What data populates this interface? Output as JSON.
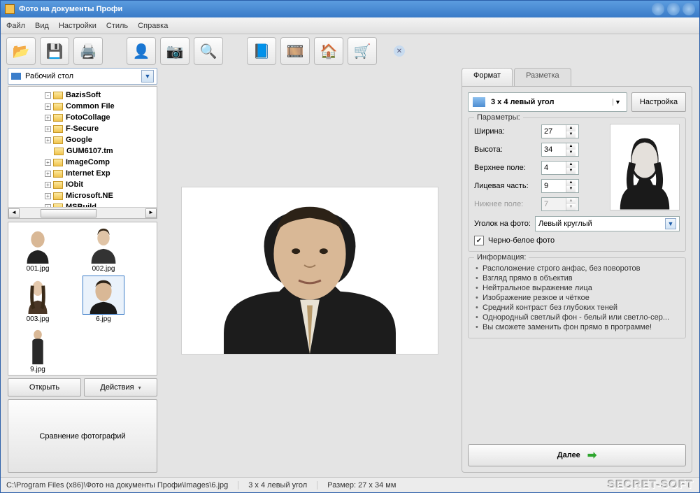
{
  "title": "Фото на документы Профи",
  "menu": [
    "Файл",
    "Вид",
    "Настройки",
    "Стиль",
    "Справка"
  ],
  "toolbar_icons": [
    "open-icon",
    "save-icon",
    "print-icon",
    "retouch-icon",
    "camera-icon",
    "search-icon",
    "help-icon",
    "video-icon",
    "home-icon",
    "cart-icon"
  ],
  "location": "Рабочий стол",
  "tree": [
    {
      "exp": "-",
      "label": "BazisSoft"
    },
    {
      "exp": "+",
      "label": "Common File"
    },
    {
      "exp": "+",
      "label": "FotoCollage"
    },
    {
      "exp": "+",
      "label": "F-Secure"
    },
    {
      "exp": "+",
      "label": "Google"
    },
    {
      "exp": "",
      "label": "GUM6107.tm"
    },
    {
      "exp": "+",
      "label": "ImageComp"
    },
    {
      "exp": "+",
      "label": "Internet Exp"
    },
    {
      "exp": "+",
      "label": "IObit"
    },
    {
      "exp": "+",
      "label": "Microsoft.NE"
    },
    {
      "exp": "+",
      "label": "MSBuild"
    }
  ],
  "thumbs": [
    {
      "name": "001.jpg",
      "sel": false
    },
    {
      "name": "002.jpg",
      "sel": false
    },
    {
      "name": "003.jpg",
      "sel": false
    },
    {
      "name": "6.jpg",
      "sel": true
    },
    {
      "name": "9.jpg",
      "sel": false
    }
  ],
  "buttons": {
    "open": "Открыть",
    "actions": "Действия",
    "compare": "Сравнение фотографий"
  },
  "tabs": {
    "format": "Формат",
    "markup": "Разметка"
  },
  "format_combo": "3 x 4 левый угол",
  "configure": "Настройка",
  "group_params": "Параметры:",
  "params": {
    "width_label": "Ширина:",
    "width": "27",
    "height_label": "Высота:",
    "height": "34",
    "top_label": "Верхнее поле:",
    "top": "4",
    "face_label": "Лицевая часть:",
    "face": "9",
    "bottom_label": "Нижнее поле:",
    "bottom": "7"
  },
  "corner_label": "Уголок на фото:",
  "corner_value": "Левый круглый",
  "bw_label": "Черно-белое фото",
  "group_info": "Информация:",
  "info": [
    "Расположение строго анфас, без поворотов",
    "Взгляд прямо в объектив",
    "Нейтральное выражение лица",
    "Изображение резкое и чёткое",
    "Средний контраст без глубоких теней",
    "Однородный светлый фон - белый или светло-сер...",
    "Вы сможете заменить фон прямо в программе!"
  ],
  "next": "Далее",
  "status": {
    "path": "C:\\Program Files (x86)\\Фото на документы Профи\\Images\\6.jpg",
    "format": "3 x 4 левый угол",
    "size": "Размер: 27 x 34 мм"
  },
  "watermark": "SECRET-SOFT"
}
